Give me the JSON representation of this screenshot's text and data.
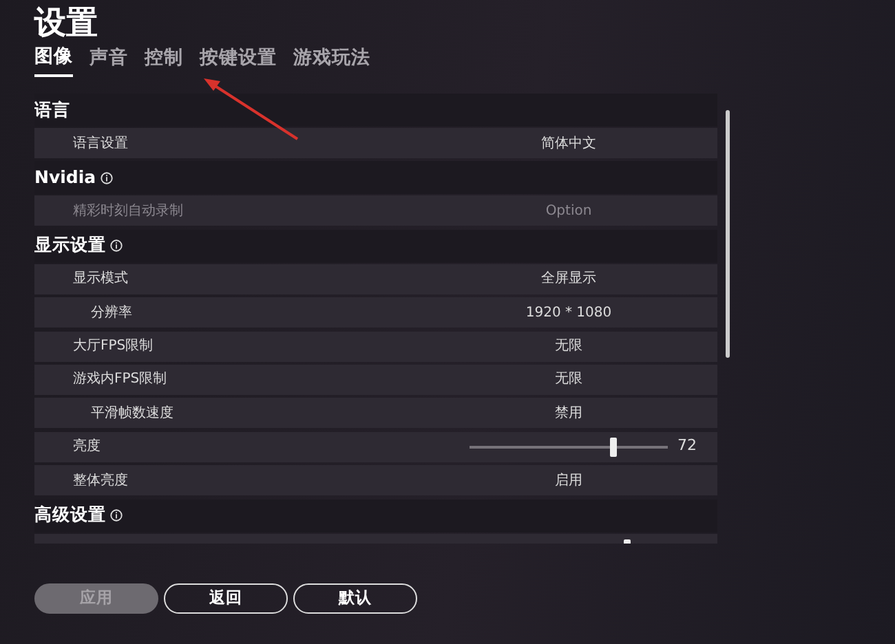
{
  "title": "设置",
  "tabs": [
    {
      "label": "图像",
      "selected": true
    },
    {
      "label": "声音",
      "selected": false
    },
    {
      "label": "控制",
      "selected": false
    },
    {
      "label": "按键设置",
      "selected": false
    },
    {
      "label": "游戏玩法",
      "selected": false
    }
  ],
  "sections": [
    {
      "heading": "语言",
      "info": false,
      "rows": [
        {
          "kind": "option",
          "label": "语言设置",
          "value": "简体中文",
          "disabled": false
        }
      ]
    },
    {
      "heading": "Nvidia",
      "info": true,
      "rows": [
        {
          "kind": "option",
          "label": "精彩时刻自动录制",
          "value": "Option",
          "disabled": true
        }
      ]
    },
    {
      "heading": "显示设置",
      "info": true,
      "rows": [
        {
          "kind": "option",
          "label": "显示模式",
          "value": "全屏显示",
          "disabled": false,
          "children": [
            {
              "kind": "option",
              "label": "分辨率",
              "value": "1920 * 1080",
              "disabled": false
            }
          ]
        },
        {
          "kind": "option",
          "label": "大厅FPS限制",
          "value": "无限",
          "disabled": false
        },
        {
          "kind": "option",
          "label": "游戏内FPS限制",
          "value": "无限",
          "disabled": false,
          "children": [
            {
              "kind": "option",
              "label": "平滑帧数速度",
              "value": "禁用",
              "disabled": false
            }
          ]
        },
        {
          "kind": "slider",
          "label": "亮度",
          "level": 0.72,
          "reading": "72",
          "disabled": false
        },
        {
          "kind": "option",
          "label": "整体亮度",
          "value": "启用",
          "disabled": false
        }
      ]
    },
    {
      "heading": "高级设置",
      "info": true,
      "rows": [
        {
          "kind": "slider",
          "level": 0.79
        }
      ]
    }
  ],
  "buttons": [
    {
      "label": "应用",
      "disabled": true
    },
    {
      "label": "返回",
      "disabled": false
    },
    {
      "label": "默认",
      "disabled": false
    }
  ]
}
